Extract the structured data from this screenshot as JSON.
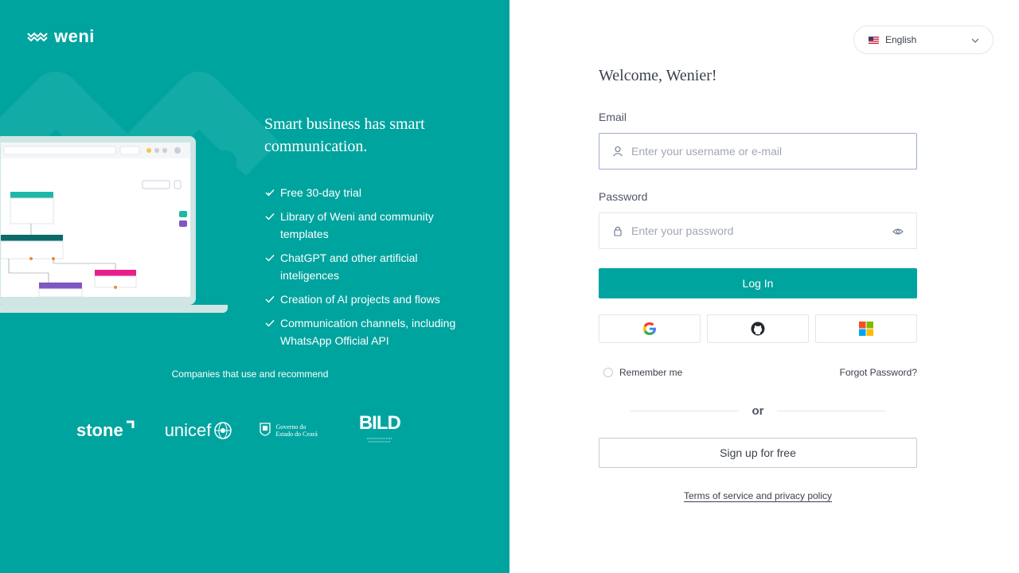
{
  "brand": {
    "logo_text": "weni"
  },
  "hero": {
    "headline": "Smart business has smart communication.",
    "features": [
      "Free 30-day trial",
      "Library of Weni and community templates",
      "ChatGPT and other artificial inteligences",
      "Creation of AI projects and flows",
      "Communication channels, including WhatsApp Official API"
    ],
    "companies_title": "Companies that use and recommend",
    "companies": {
      "stone": "stone",
      "unicef": "unicef",
      "ceara_line1": "Governo do",
      "ceara_line2": "Estado do Ceará",
      "bild": "BILD"
    }
  },
  "language": {
    "selected": "English"
  },
  "form": {
    "welcome": "Welcome, Wenier!",
    "email_label": "Email",
    "email_placeholder": "Enter your username or e-mail",
    "password_label": "Password",
    "password_placeholder": "Enter your password",
    "login_label": "Log In",
    "remember_label": "Remember me",
    "forgot_label": "Forgot Password?",
    "or_label": "or",
    "signup_label": "Sign up for free",
    "terms_label": "Terms of service and privacy policy"
  },
  "colors": {
    "primary": "#00A49F",
    "text": "#3b414d",
    "border": "#E2E6ED"
  }
}
